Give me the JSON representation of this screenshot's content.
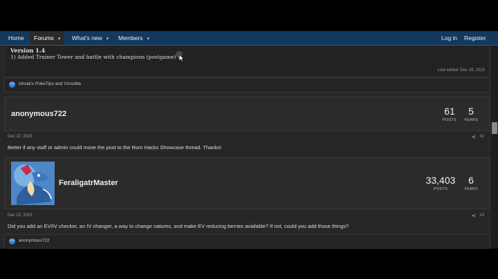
{
  "nav": {
    "home": "Home",
    "forums": "Forums",
    "whats_new": "What's new",
    "members": "Members",
    "login": "Log in",
    "register": "Register",
    "caret": "▾"
  },
  "post1": {
    "version_title": "Version 1.4",
    "version_line": "1) Added Trainer Tower and battle with champions (postgame)",
    "last_edited": "Last edited: Dec 29, 2023",
    "reactions": "Ishrak's PokeTips and V1ncible"
  },
  "post2": {
    "username": "anonymous722",
    "posts_value": "61",
    "posts_label": "POSTS",
    "years_value": "5",
    "years_label": "YEARS",
    "date": "Dec 22, 2023",
    "post_number": "#2",
    "text": "Better if any staff or admin could move the post to the Rom Hacks Showcase thread. Thanks!"
  },
  "post3": {
    "username": "FeraligatrMaster",
    "posts_value": "33,403",
    "posts_label": "POSTS",
    "years_value": "6",
    "years_label": "YEARS",
    "date": "Dec 22, 2023",
    "post_number": "#3",
    "text": "Did you add an EV/IV checker, an IV changer, a way to change natures, and make EV reducing berries available? If not, could you add those things?",
    "reactions": "anonymous722"
  },
  "icons": {
    "like": "like-icon",
    "share": "share-icon",
    "share_glyph": "⋞"
  },
  "colors": {
    "navbar": "#14395e",
    "page_bg": "#272727",
    "like_blue": "#2d7fd6"
  }
}
